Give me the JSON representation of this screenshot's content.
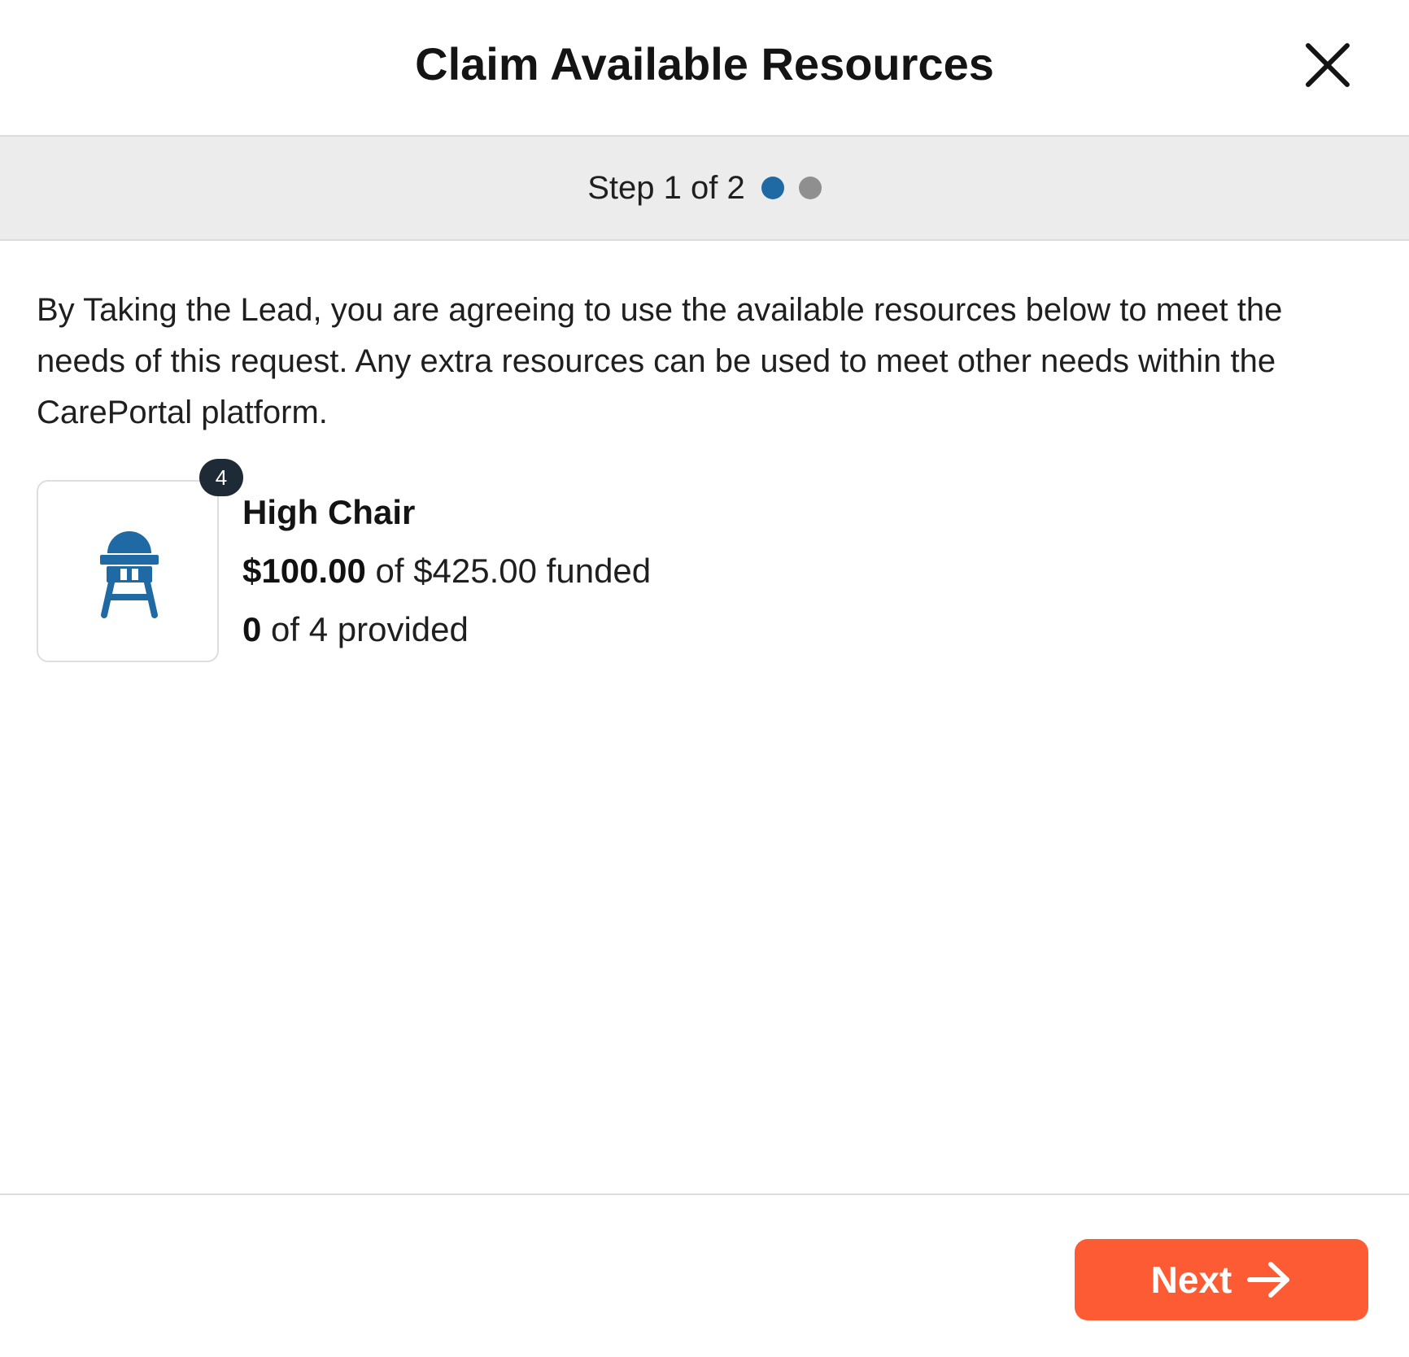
{
  "dialog": {
    "title": "Claim Available Resources",
    "close_icon": "close-icon"
  },
  "steps": {
    "label": "Step 1 of 2",
    "current": 1,
    "total": 2,
    "active_color": "#1f6aa5",
    "inactive_color": "#8f8f8f"
  },
  "description": "By Taking the Lead, you are agreeing to use the available resources below to meet the needs of this request. Any extra resources can be used to meet other needs within the CarePortal platform.",
  "resource": {
    "icon": "high-chair-icon",
    "icon_color": "#1f6aa5",
    "badge_count": "4",
    "name": "High Chair",
    "funded_amount": "$100.00",
    "funded_suffix": " of $425.00 funded",
    "provided_count": "0",
    "provided_suffix": " of 4 provided"
  },
  "footer": {
    "next_label": "Next",
    "next_icon": "arrow-right-icon",
    "next_color": "#fd5b33"
  }
}
